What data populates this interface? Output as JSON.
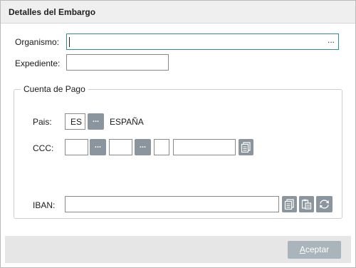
{
  "dialog": {
    "title": "Detalles del Embargo",
    "organismo_label": "Organismo:",
    "organismo_value": "",
    "organismo_more": "...",
    "expediente_label": "Expediente:",
    "expediente_value": ""
  },
  "cuenta": {
    "legend": "Cuenta de Pago",
    "pais_label": "Pais:",
    "pais_code": "ES",
    "pais_name": "ESPAÑA",
    "more": "...",
    "ccc_label": "CCC:",
    "ccc_entidad": "",
    "ccc_oficina": "",
    "ccc_dc": "",
    "ccc_cuenta": "",
    "iban_label": "IBAN:",
    "iban_value": ""
  },
  "icons": {
    "copy": "copy-icon",
    "paste": "paste-icon",
    "refresh": "refresh-icon"
  },
  "footer": {
    "accept_first": "A",
    "accept_rest": "ceptar"
  }
}
